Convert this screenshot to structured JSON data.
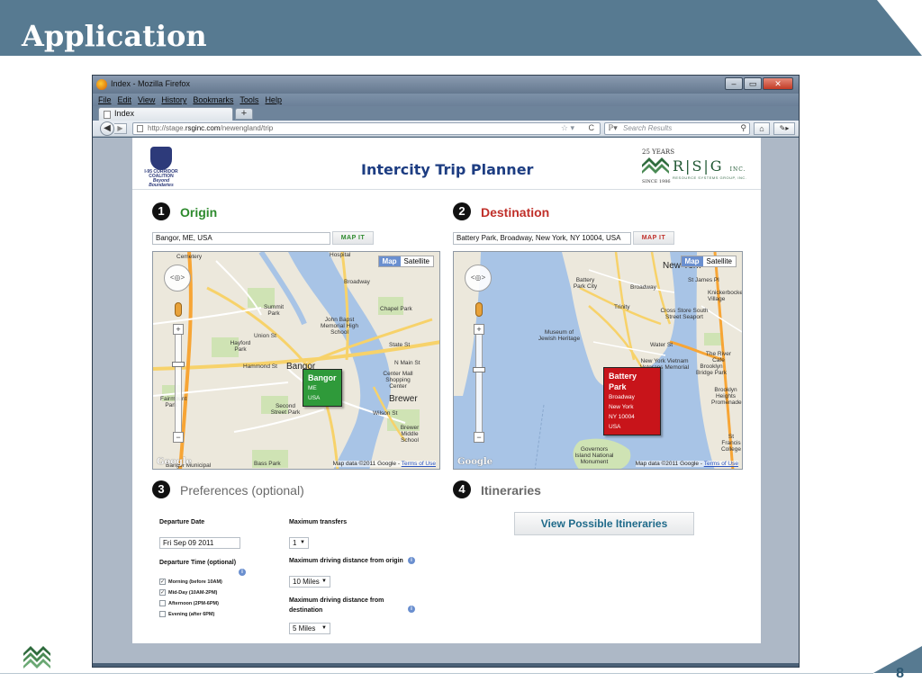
{
  "slide": {
    "title": "Application",
    "page_number": "8"
  },
  "browser": {
    "window_title": "Index - Mozilla Firefox",
    "menu": [
      "File",
      "Edit",
      "View",
      "History",
      "Bookmarks",
      "Tools",
      "Help"
    ],
    "tab_label": "Index",
    "new_tab": "+",
    "url_prefix": "http://stage.",
    "url_domain": "rsginc.com",
    "url_path": "/newengland/trip",
    "search_placeholder": "Search Results",
    "buttons": {
      "minimize": "–",
      "maximize": "▭",
      "close": "✕"
    }
  },
  "app": {
    "title": "Intercity Trip Planner",
    "i95_logo_text": "I-95 CORRIDOR COALITION",
    "i95_logo_tagline": "Beyond Boundaries",
    "rsg": {
      "years": "25 YEARS",
      "letters": "R|S|G",
      "inc": "INC.",
      "subtitle": "RESOURCE SYSTEMS GROUP, INC.",
      "since": "SINCE 1986"
    }
  },
  "origin": {
    "step": "1",
    "title": "Origin",
    "address": "Bangor, ME, USA",
    "map_button": "MAP IT",
    "map_type": {
      "map": "Map",
      "satellite": "Satellite"
    },
    "info": {
      "title": "Bangor",
      "lines": [
        "ME",
        "USA"
      ]
    },
    "labels": {
      "cemetery": "Cemetery",
      "hospital": "Hospital",
      "summit_park": "Summit Park",
      "john_bapst": "John Bapst Memorial High School",
      "chapel_park": "Chapel Park",
      "hayford_park": "Hayford Park",
      "bangor": "Bangor",
      "center_mall": "Center Mall Shopping Center",
      "fairmount_park": "Fairmount Park",
      "second_street_park": "Second Street Park",
      "brewer": "Brewer",
      "brewer_middle": "Brewer Middle School",
      "bangor_municipal": "Bangor Municipal",
      "bass_park": "Bass Park",
      "hammond_st": "Hammond St",
      "union_st": "Union St",
      "state_st": "State St",
      "broadway": "Broadway",
      "n_main_st": "N Main St",
      "wilson_st": "Wilson St"
    },
    "shields": [
      "222",
      "2",
      "15",
      "222",
      "100",
      "100",
      "2",
      "202",
      "9",
      "1A",
      "9",
      "1A"
    ],
    "google": "Google",
    "attribution": "Map data ©2011 Google - ",
    "terms": "Terms of Use"
  },
  "destination": {
    "step": "2",
    "title": "Destination",
    "address": "Battery Park, Broadway, New York, NY 10004, USA",
    "map_button": "MAP IT",
    "map_type": {
      "map": "Map",
      "satellite": "Satellite"
    },
    "info": {
      "title": "Battery Park",
      "lines": [
        "Broadway",
        "New York",
        "NY 10004",
        "USA"
      ]
    },
    "labels": {
      "new_york": "New York",
      "battery_park_city": "Battery Park City",
      "trinity": "Trinity",
      "knickerbocker": "Knickerbocker Village",
      "cross_store": "Cross Store South Street Seaport",
      "museum_jewish": "Museum of Jewish Heritage",
      "new_york_vietnam": "New York Vietnam Veterans Memorial",
      "river_cafe": "The River Cafe",
      "brooklyn_bridge_park": "Brooklyn Bridge Park",
      "governors_island": "Governors Island National Monument",
      "water_st": "Water St",
      "broadway": "Broadway",
      "st_james": "St James Pl",
      "brooklyn_heights": "Brooklyn Heights Promenade",
      "st_francis": "St Francis College"
    },
    "shields": [
      "9A",
      "9A",
      "278"
    ],
    "google": "Google",
    "attribution": "Map data ©2011 Google - ",
    "terms": "Terms of Use"
  },
  "preferences": {
    "step": "3",
    "title": "Preferences (optional)",
    "departure_date_label": "Departure Date",
    "departure_date_value": "Fri Sep 09 2011",
    "departure_time_label": "Departure Time (optional)",
    "times": [
      {
        "label": "Morning (before 10AM)",
        "checked": true
      },
      {
        "label": "Mid-Day (10AM-2PM)",
        "checked": true
      },
      {
        "label": "Afternoon (2PM-6PM)",
        "checked": false
      },
      {
        "label": "Evening (after 6PM)",
        "checked": false
      }
    ],
    "max_transfers_label": "Maximum transfers",
    "max_transfers_value": "1",
    "max_drive_origin_label": "Maximum driving distance from origin",
    "max_drive_origin_value": "10 Miles",
    "max_drive_dest_label": "Maximum driving distance from destination",
    "max_drive_dest_value": "5 Miles"
  },
  "itineraries": {
    "step": "4",
    "title": "Itineraries",
    "button": "View Possible Itineraries"
  },
  "colors": {
    "header_band": "#577a91",
    "origin_green": "#2d8a2d",
    "destination_red": "#c0302a",
    "title_blue": "#1d3d82"
  }
}
